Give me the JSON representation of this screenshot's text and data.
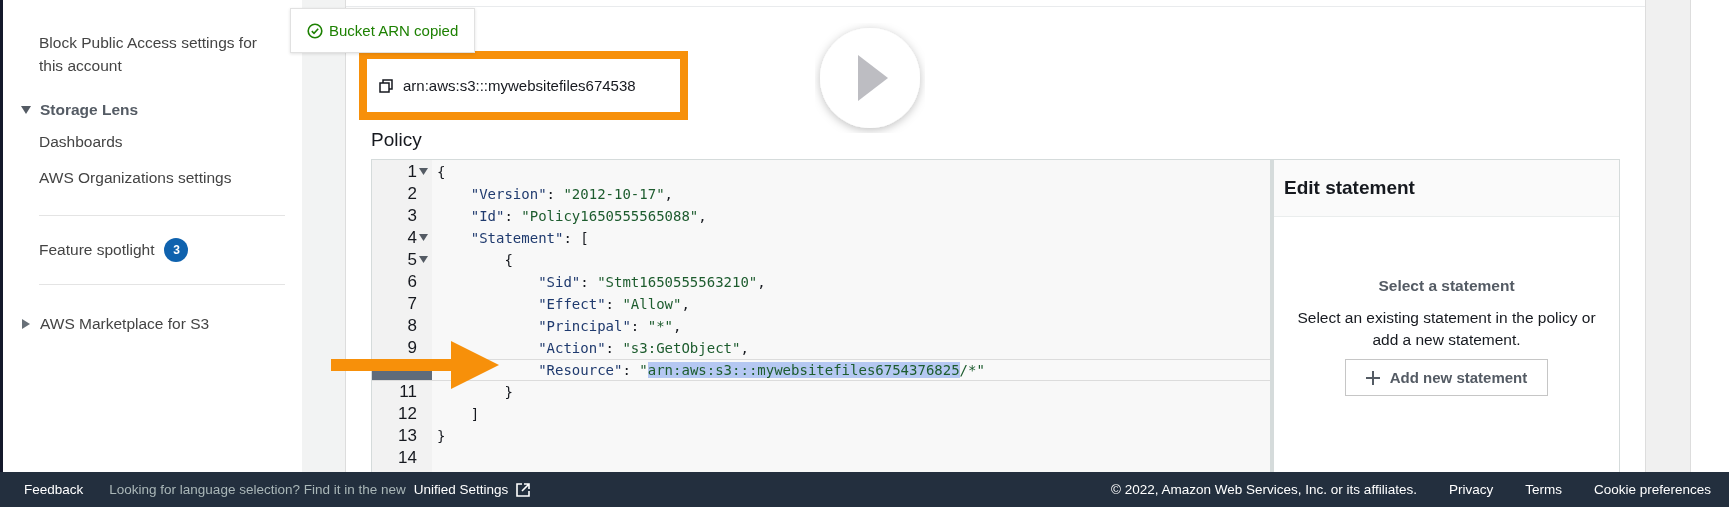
{
  "sidebar": {
    "items": [
      {
        "kind": "link",
        "label": "Block Public Access settings for this account"
      },
      {
        "kind": "section",
        "label": "Storage Lens",
        "expanded": true
      },
      {
        "kind": "link",
        "label": "Dashboards"
      },
      {
        "kind": "link",
        "label": "AWS Organizations settings"
      },
      {
        "kind": "divider"
      },
      {
        "kind": "badge-link",
        "label": "Feature spotlight",
        "badge": "3"
      },
      {
        "kind": "divider"
      },
      {
        "kind": "section",
        "label": "AWS Marketplace for S3",
        "expanded": false
      }
    ]
  },
  "toast": {
    "text": "Bucket ARN copied"
  },
  "bucket_arn": {
    "text": "arn:aws:s3:::mywebsitefiles674538",
    "highlighted": true
  },
  "policy": {
    "label": "Policy",
    "lines": [
      {
        "number": "1",
        "foldable": true,
        "active": false,
        "tokens": [
          {
            "kind": "punct",
            "text": "{"
          }
        ],
        "children": [
          {
            "number": "2",
            "foldable": false,
            "active": false,
            "tokens": [
              {
                "kind": "key",
                "text": "\"Version\""
              },
              {
                "kind": "punct",
                "text": ": "
              },
              {
                "kind": "string",
                "text": "\"2012-10-17\""
              },
              {
                "kind": "punct",
                "text": ","
              }
            ]
          },
          {
            "number": "3",
            "foldable": false,
            "active": false,
            "tokens": [
              {
                "kind": "key",
                "text": "\"Id\""
              },
              {
                "kind": "punct",
                "text": ": "
              },
              {
                "kind": "string",
                "text": "\"Policy1650555565088\""
              },
              {
                "kind": "punct",
                "text": ","
              }
            ]
          },
          {
            "number": "4",
            "foldable": true,
            "active": false,
            "tokens": [
              {
                "kind": "key",
                "text": "\"Statement\""
              },
              {
                "kind": "punct",
                "text": ": ["
              }
            ],
            "children": [
              {
                "number": "5",
                "foldable": true,
                "active": false,
                "tokens": [
                  {
                    "kind": "punct",
                    "text": "{"
                  }
                ],
                "children": [
                  {
                    "number": "6",
                    "foldable": false,
                    "active": false,
                    "tokens": [
                      {
                        "kind": "key",
                        "text": "\"Sid\""
                      },
                      {
                        "kind": "punct",
                        "text": ": "
                      },
                      {
                        "kind": "string",
                        "text": "\"Stmt1650555563210\""
                      },
                      {
                        "kind": "punct",
                        "text": ","
                      }
                    ]
                  },
                  {
                    "number": "7",
                    "foldable": false,
                    "active": false,
                    "tokens": [
                      {
                        "kind": "key",
                        "text": "\"Effect\""
                      },
                      {
                        "kind": "punct",
                        "text": ": "
                      },
                      {
                        "kind": "string",
                        "text": "\"Allow\""
                      },
                      {
                        "kind": "punct",
                        "text": ","
                      }
                    ]
                  },
                  {
                    "number": "8",
                    "foldable": false,
                    "active": false,
                    "tokens": [
                      {
                        "kind": "key",
                        "text": "\"Principal\""
                      },
                      {
                        "kind": "punct",
                        "text": ": "
                      },
                      {
                        "kind": "string",
                        "text": "\"*\""
                      },
                      {
                        "kind": "punct",
                        "text": ","
                      }
                    ]
                  },
                  {
                    "number": "9",
                    "foldable": false,
                    "active": false,
                    "tokens": [
                      {
                        "kind": "key",
                        "text": "\"Action\""
                      },
                      {
                        "kind": "punct",
                        "text": ": "
                      },
                      {
                        "kind": "string",
                        "text": "\"s3:GetObject\""
                      },
                      {
                        "kind": "punct",
                        "text": ","
                      }
                    ]
                  },
                  {
                    "foldable": false,
                    "active": true,
                    "tokens": [
                      {
                        "kind": "key",
                        "text": "\"Resource\""
                      },
                      {
                        "kind": "punct",
                        "text": ": "
                      },
                      {
                        "kind": "string",
                        "text": "\""
                      },
                      {
                        "kind": "selected",
                        "text": "arn:aws:s3:::mywebsitefiles6754376825"
                      },
                      {
                        "kind": "string",
                        "text": "/*\""
                      }
                    ]
                  }
                ]
              },
              {
                "number": "11",
                "foldable": false,
                "active": false,
                "tokens": [
                  {
                    "kind": "punct",
                    "text": "}"
                  }
                ]
              }
            ]
          },
          {
            "number": "12",
            "foldable": false,
            "active": false,
            "tokens": [
              {
                "kind": "punct",
                "text": "]"
              }
            ]
          }
        ]
      },
      {
        "number": "13",
        "foldable": false,
        "active": false,
        "tokens": [
          {
            "kind": "punct",
            "text": "}"
          }
        ]
      },
      {
        "number": "14",
        "foldable": false,
        "active": false
      }
    ]
  },
  "edit_statement": {
    "title": "Edit statement",
    "empty_title": "Select a statement",
    "empty_text": "Select an existing statement in the policy or add a new statement.",
    "button": "Add new statement"
  },
  "footer": {
    "feedback": "Feedback",
    "language_hint": "Looking for language selection? Find it in the new",
    "settings_link": "Unified Settings",
    "copyright": "© 2022, Amazon Web Services, Inc. or its affiliates.",
    "links": [
      "Privacy",
      "Terms",
      "Cookie preferences"
    ]
  }
}
